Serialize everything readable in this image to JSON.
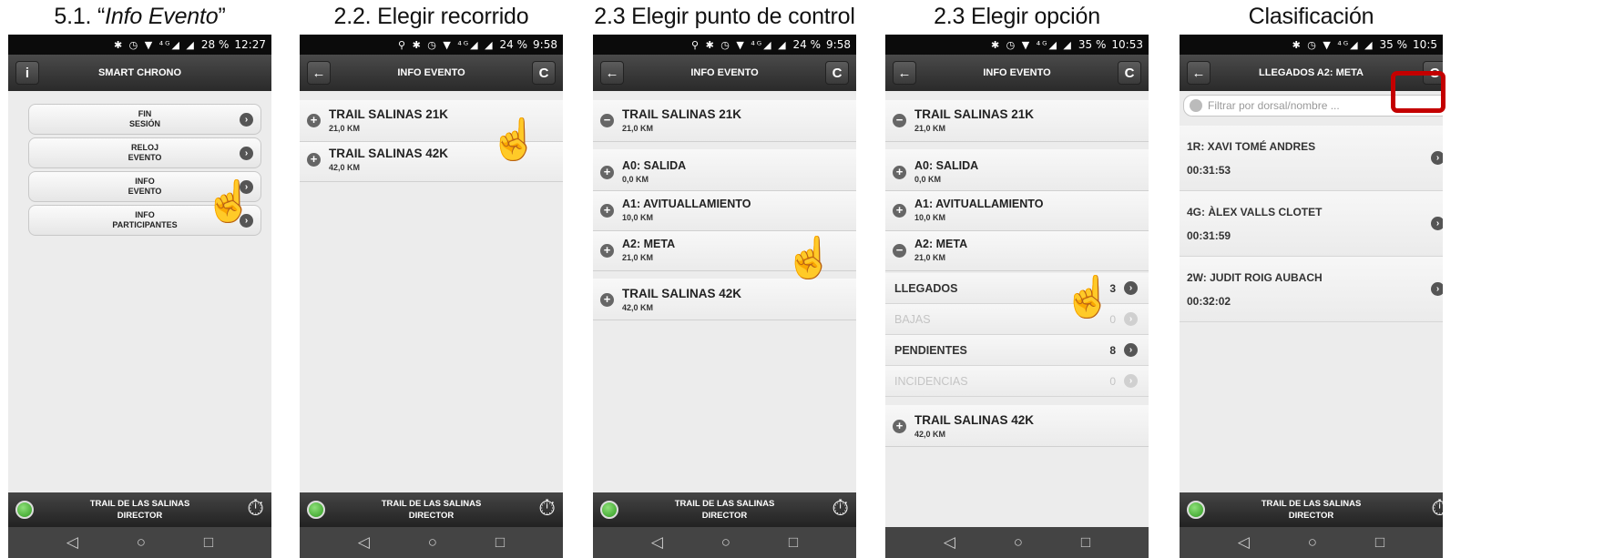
{
  "captions": [
    "5.1. “",
    "Info Evento",
    "”",
    "2.2. Elegir recorrido",
    "2.3 Elegir punto de control",
    "2.3 Elegir opción",
    "Clasificación"
  ],
  "status": {
    "p1": {
      "icons": "✱ ◷ ▼ ⁴ᴳ◢ ◢",
      "battery": "28 %",
      "time": "12:27"
    },
    "p2": {
      "icons": "⚲ ✱ ◷ ▼ ⁴ᴳ◢ ◢",
      "battery": "24 %",
      "time": "9:58"
    },
    "p3": {
      "icons": "⚲ ✱ ◷ ▼ ⁴ᴳ◢ ◢",
      "battery": "24 %",
      "time": "9:58"
    },
    "p4": {
      "icons": "✱ ◷ ▼ ⁴ᴳ◢ ◢",
      "battery": "35 %",
      "time": "10:53"
    },
    "p5": {
      "icons": "✱ ◷ ▼ ⁴ᴳ◢ ◢",
      "battery": "35 %",
      "time": "10:5"
    }
  },
  "appbar": {
    "p1_title": "SMART CHRONO",
    "info_btn": "i",
    "info_title": "INFO EVENTO",
    "p5_title": "LLEGADOS A2: META",
    "back": "←",
    "refresh": "C"
  },
  "menu": [
    {
      "l1": "FIN",
      "l2": "SESIÓN"
    },
    {
      "l1": "RELOJ",
      "l2": "EVENTO"
    },
    {
      "l1": "INFO",
      "l2": "EVENTO"
    },
    {
      "l1": "INFO",
      "l2": "PARTICIPANTES"
    }
  ],
  "routes": [
    {
      "name": "TRAIL SALINAS 21K",
      "dist": "21,0 KM"
    },
    {
      "name": "TRAIL SALINAS 42K",
      "dist": "42,0 KM"
    }
  ],
  "checkpoints": [
    {
      "name": "A0: SALIDA",
      "dist": "0,0 KM"
    },
    {
      "name": "A1: AVITUALLAMIENTO",
      "dist": "10,0 KM"
    },
    {
      "name": "A2: META",
      "dist": "21,0 KM"
    }
  ],
  "options": [
    {
      "label": "LLEGADOS",
      "count": "3"
    },
    {
      "label": "BAJAS",
      "count": "0"
    },
    {
      "label": "PENDIENTES",
      "count": "8"
    },
    {
      "label": "INCIDENCIAS",
      "count": "0"
    }
  ],
  "search": {
    "placeholder": "Filtrar por dorsal/nombre ..."
  },
  "runners": [
    {
      "name": "1R: XAVI TOMÉ ANDRES",
      "time": "00:31:53"
    },
    {
      "name": "4G: ÀLEX VALLS CLOTET",
      "time": "00:31:59"
    },
    {
      "name": "2W: JUDIT ROIG AUBACH",
      "time": "00:32:02"
    }
  ],
  "footer": {
    "line1": "TRAIL DE LAS SALINAS",
    "line2": "DIRECTOR",
    "timer_icon": "stopwatch-icon"
  },
  "nav": {
    "back": "◁",
    "home": "○",
    "recent": "□"
  },
  "icons": {
    "plus": "+",
    "minus": "−",
    "arrow": "›",
    "hand": "☝"
  }
}
